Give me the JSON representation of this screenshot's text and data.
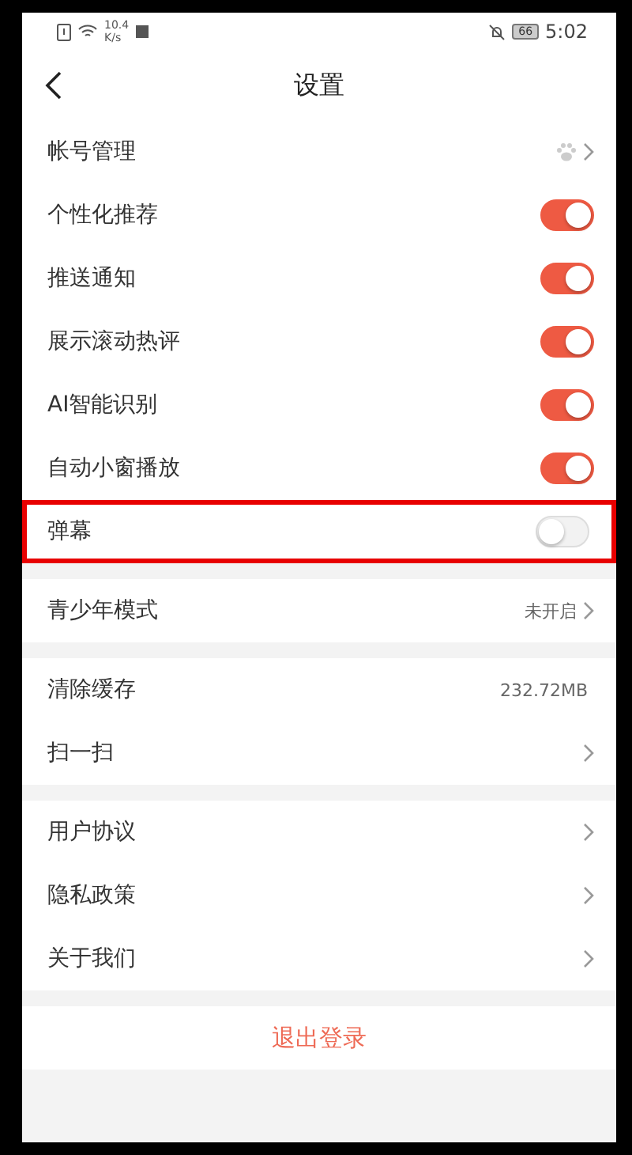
{
  "status_bar": {
    "speed_value": "10.4",
    "speed_unit": "K/s",
    "battery": "66",
    "time": "5:02"
  },
  "header": {
    "title": "设置"
  },
  "groups": [
    {
      "items": [
        {
          "kind": "account",
          "label": "帐号管理",
          "highlighted": false
        },
        {
          "kind": "toggle",
          "label": "个性化推荐",
          "on": true,
          "highlighted": false
        },
        {
          "kind": "toggle",
          "label": "推送通知",
          "on": true,
          "highlighted": false
        },
        {
          "kind": "toggle",
          "label": "展示滚动热评",
          "on": true,
          "highlighted": false
        },
        {
          "kind": "toggle",
          "label": "AI智能识别",
          "on": true,
          "highlighted": false
        },
        {
          "kind": "toggle",
          "label": "自动小窗播放",
          "on": true,
          "highlighted": false
        },
        {
          "kind": "toggle",
          "label": "弹幕",
          "on": false,
          "highlighted": true
        }
      ]
    },
    {
      "items": [
        {
          "kind": "link",
          "label": "青少年模式",
          "value": "未开启",
          "highlighted": false
        }
      ]
    },
    {
      "items": [
        {
          "kind": "value",
          "label": "清除缓存",
          "value": "232.72MB",
          "highlighted": false
        },
        {
          "kind": "link",
          "label": "扫一扫",
          "highlighted": false
        }
      ]
    },
    {
      "items": [
        {
          "kind": "link",
          "label": "用户协议",
          "highlighted": false
        },
        {
          "kind": "link",
          "label": "隐私政策",
          "highlighted": false
        },
        {
          "kind": "link",
          "label": "关于我们",
          "highlighted": false
        }
      ]
    }
  ],
  "logout": {
    "label": "退出登录"
  }
}
